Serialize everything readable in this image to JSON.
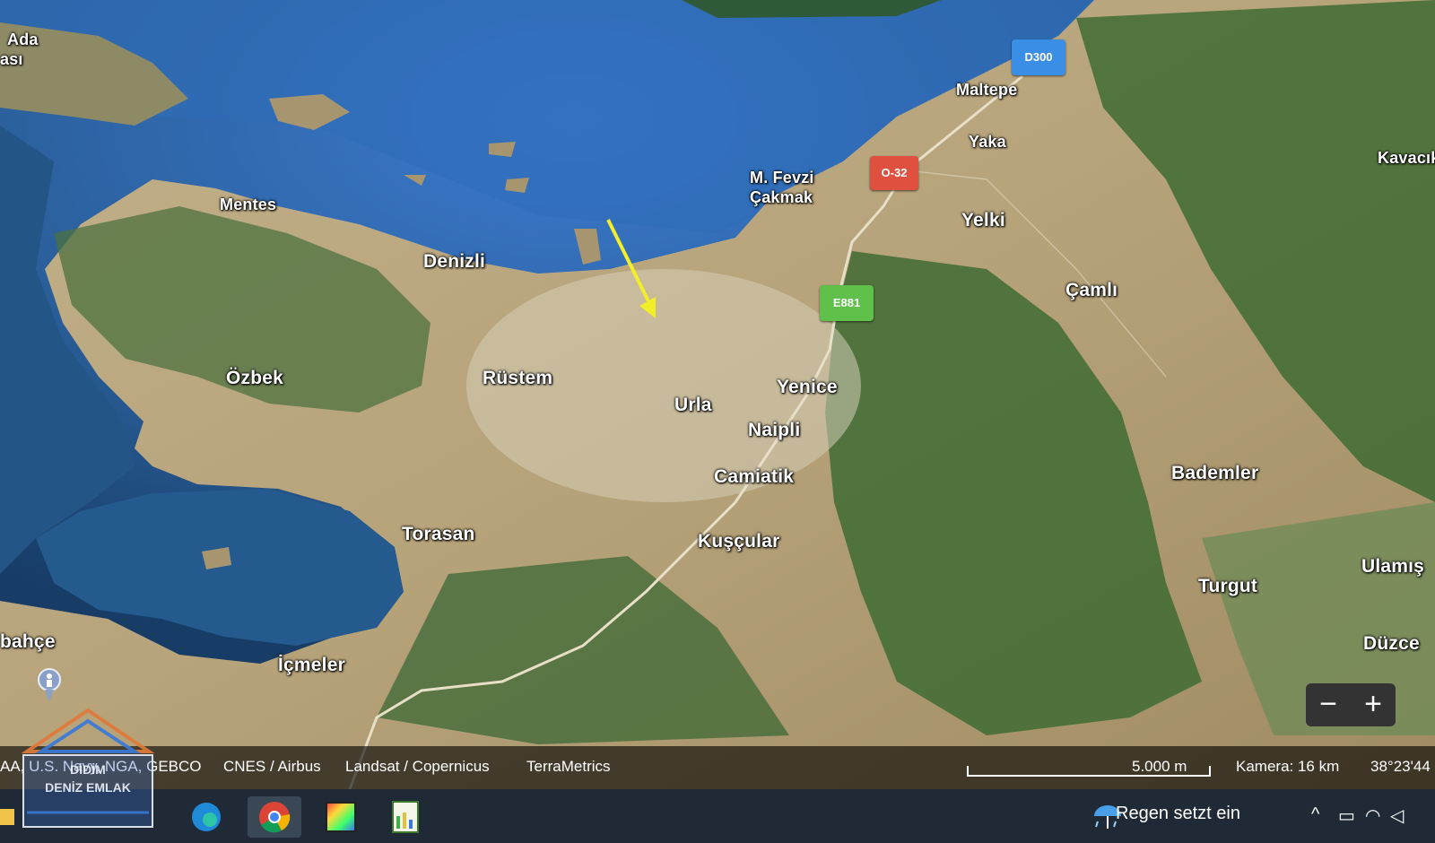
{
  "map": {
    "places": {
      "ada": "Ada",
      "asi": "ası",
      "mentes": "Mentes",
      "denizli": "Denizli",
      "ozbek": "Özbek",
      "rustem": "Rüstem",
      "urla": "Urla",
      "yenice": "Yenice",
      "naipli": "Naipli",
      "camiatik": "Camiatik",
      "kuscular": "Kuşçular",
      "torasan": "Torasan",
      "bahce": "bahçe",
      "icmeler": "İçmeler",
      "maltepe": "Maltepe",
      "yaka": "Yaka",
      "mfevzi": "M. Fevzi",
      "cakmak": "Çakmak",
      "yelki": "Yelki",
      "camli": "Çamlı",
      "kavacik": "Kavacık",
      "bademler": "Bademler",
      "turgut": "Turgut",
      "ulamis": "Ulamış",
      "duzce": "Düzce"
    },
    "shields": {
      "d300": "D300",
      "o32": "O-32",
      "e881": "E881"
    },
    "attribution": {
      "sources": "AA, U.S. Navy, NGA, GEBCO",
      "cnes": "CNES / Airbus",
      "landsat": "Landsat / Copernicus",
      "terra": "TerraMetrics"
    },
    "scale_label": "5.000 m",
    "camera": "Kamera: 16 km",
    "coordinates": "38°23'44",
    "zoom_out_label": "−",
    "zoom_in_label": "+",
    "colors": {
      "sea": "#2a5f9a",
      "land": "#b9a37c",
      "forest": "#3f6b34",
      "arrow": "#f2ee2a",
      "shield_blue": "#3b8ee6",
      "shield_red": "#e0503f",
      "shield_green": "#5fc04a"
    }
  },
  "watermark": {
    "line1": "DİDİM",
    "line2": "DENİZ EMLAK"
  },
  "taskbar": {
    "weather": "Regen setzt ein",
    "icons": [
      "explorer-icon",
      "edge-icon",
      "chrome-icon",
      "paint-icon",
      "notepad-icon"
    ]
  }
}
